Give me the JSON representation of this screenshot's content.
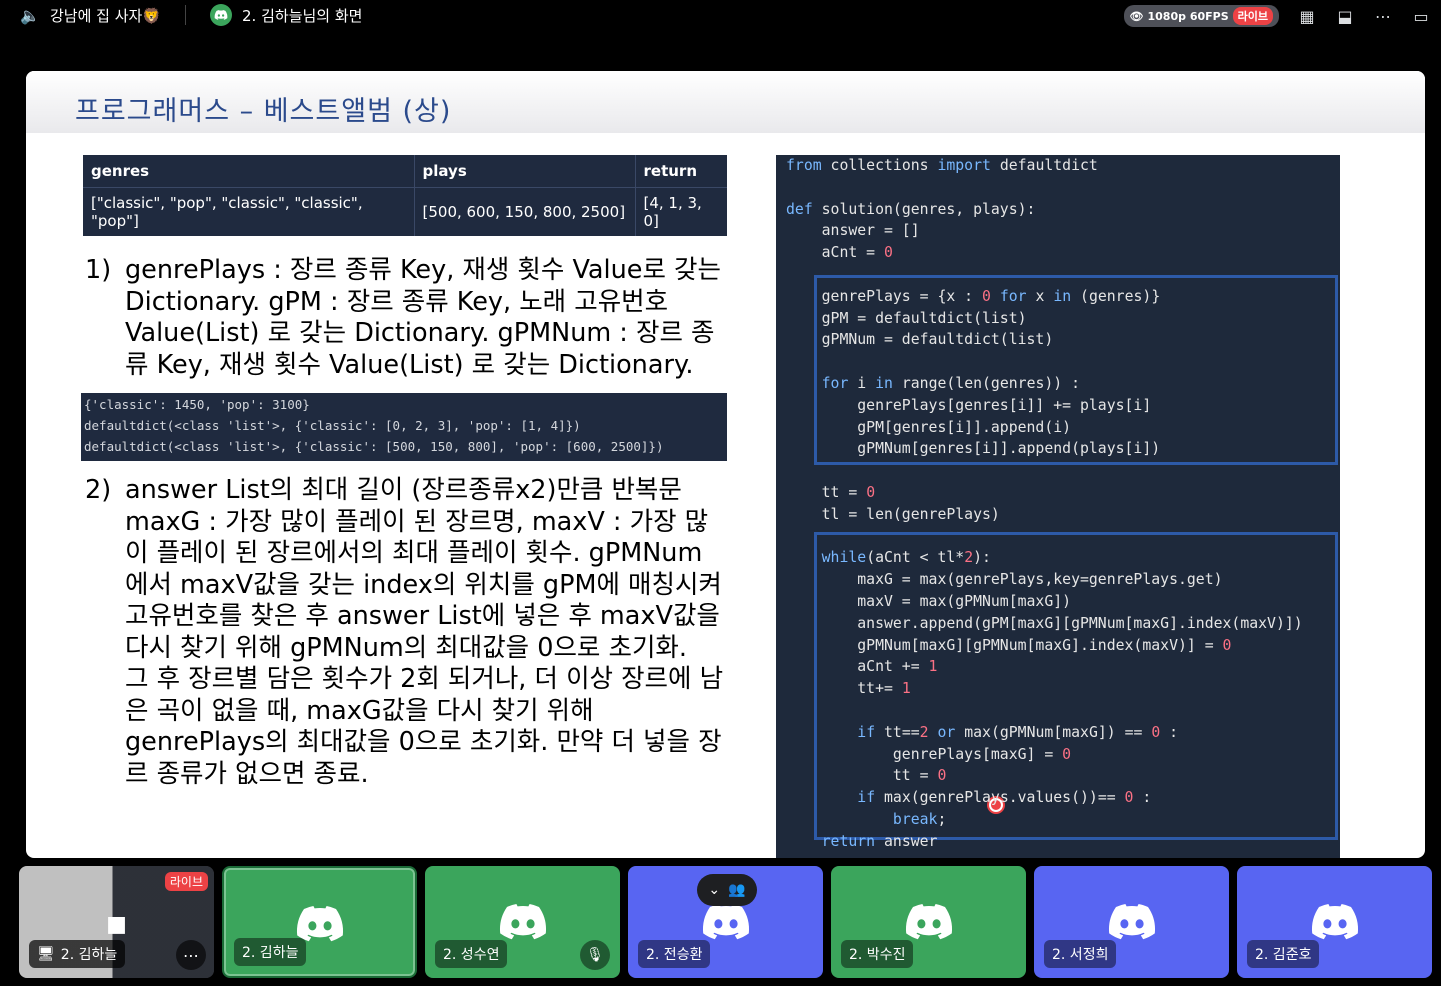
{
  "topbar": {
    "channel_name": "강남에 집 사자🦁",
    "stream_title": "2. 김하늘님의 화면",
    "quality": "1080p 60FPS",
    "live_label": "라이브"
  },
  "slide": {
    "title": "프로그래머스 – 베스트앨범 (상)",
    "table": {
      "headers": [
        "genres",
        "plays",
        "return"
      ],
      "row": [
        "[\"classic\", \"pop\", \"classic\", \"classic\", \"pop\"]",
        "[500, 600, 150, 800, 2500]",
        "[4, 1, 3, 0]"
      ]
    },
    "step1_num": "1)",
    "step1_text": "genrePlays : 장르 종류 Key, 재생 횟수 Value로 갖는 Dictionary. gPM : 장르 종류 Key, 노래 고유번호 Value(List) 로 갖는 Dictionary. gPMNum : 장르 종류 Key, 재생 횟수 Value(List) 로 갖는 Dictionary.",
    "output_lines": [
      "{'classic': 1450, 'pop': 3100}",
      "defaultdict(<class 'list'>, {'classic': [0, 2, 3], 'pop': [1, 4]})",
      "defaultdict(<class 'list'>, {'classic': [500, 150, 800], 'pop': [600, 2500]})"
    ],
    "step2_num": "2)",
    "step2_text": "answer List의 최대 길이 (장르종류x2)만큼 반복문 maxG : 가장 많이 플레이 된 장르명, maxV : 가장 많이 플레이 된 장르에서의 최대 플레이 횟수. gPMNum에서 maxV값을 갖는 index의 위치를 gPM에 매칭시켜 고유번호를 찾은 후 answer List에 넣은 후 maxV값을 다시 찾기 위해 gPMNum의 최대값을 0으로 초기화.",
    "step2_text_b": "그 후 장르별 담은 횟수가 2회 되거나, 더 이상 장르에 남은 곡이 없을 때, maxG값을 다시 찾기 위해 genrePlays의 최대값을 0으로 초기화. 만약 더 넣을 장르 종류가 없으면 종료."
  },
  "code_lines": [
    "from collections import defaultdict",
    "",
    "def solution(genres, plays):",
    "    answer = []",
    "    aCnt = 0",
    "",
    "    genrePlays = {x : 0 for x in (genres)}",
    "    gPM = defaultdict(list)",
    "    gPMNum = defaultdict(list)",
    "",
    "    for i in range(len(genres)) :",
    "        genrePlays[genres[i]] += plays[i]",
    "        gPM[genres[i]].append(i)",
    "        gPMNum[genres[i]].append(plays[i])",
    "",
    "    tt = 0",
    "    tl = len(genrePlays)",
    "",
    "    while(aCnt < tl*2):",
    "        maxG = max(genrePlays,key=genrePlays.get)",
    "        maxV = max(gPMNum[maxG])",
    "        answer.append(gPM[maxG][gPMNum[maxG].index(maxV)])",
    "        gPMNum[maxG][gPMNum[maxG].index(maxV)] = 0",
    "        aCnt += 1",
    "        tt+= 1",
    "",
    "        if tt==2 or max(gPMNum[maxG]) == 0 :",
    "            genrePlays[maxG] = 0",
    "            tt = 0",
    "        if max(genrePlays.values())== 0 :",
    "            break;",
    "    return answer"
  ],
  "participants": [
    {
      "name": "2. 김하늘",
      "live_label": "라이브",
      "kind": "screen"
    },
    {
      "name": "2. 김하늘",
      "kind": "green",
      "active": true
    },
    {
      "name": "2. 성수연",
      "kind": "green",
      "muted": true
    },
    {
      "name": "2. 전승환",
      "kind": "blurple"
    },
    {
      "name": "2. 박수진",
      "kind": "green"
    },
    {
      "name": "2. 서정희",
      "kind": "blurple"
    },
    {
      "name": "2. 김준호",
      "kind": "blurple"
    }
  ],
  "colors": {
    "discord_green": "#3ba55c",
    "discord_blurple": "#5865f2",
    "live_red": "#ed4245",
    "code_bg": "#1e293b",
    "title_blue": "#2b4a8c"
  }
}
